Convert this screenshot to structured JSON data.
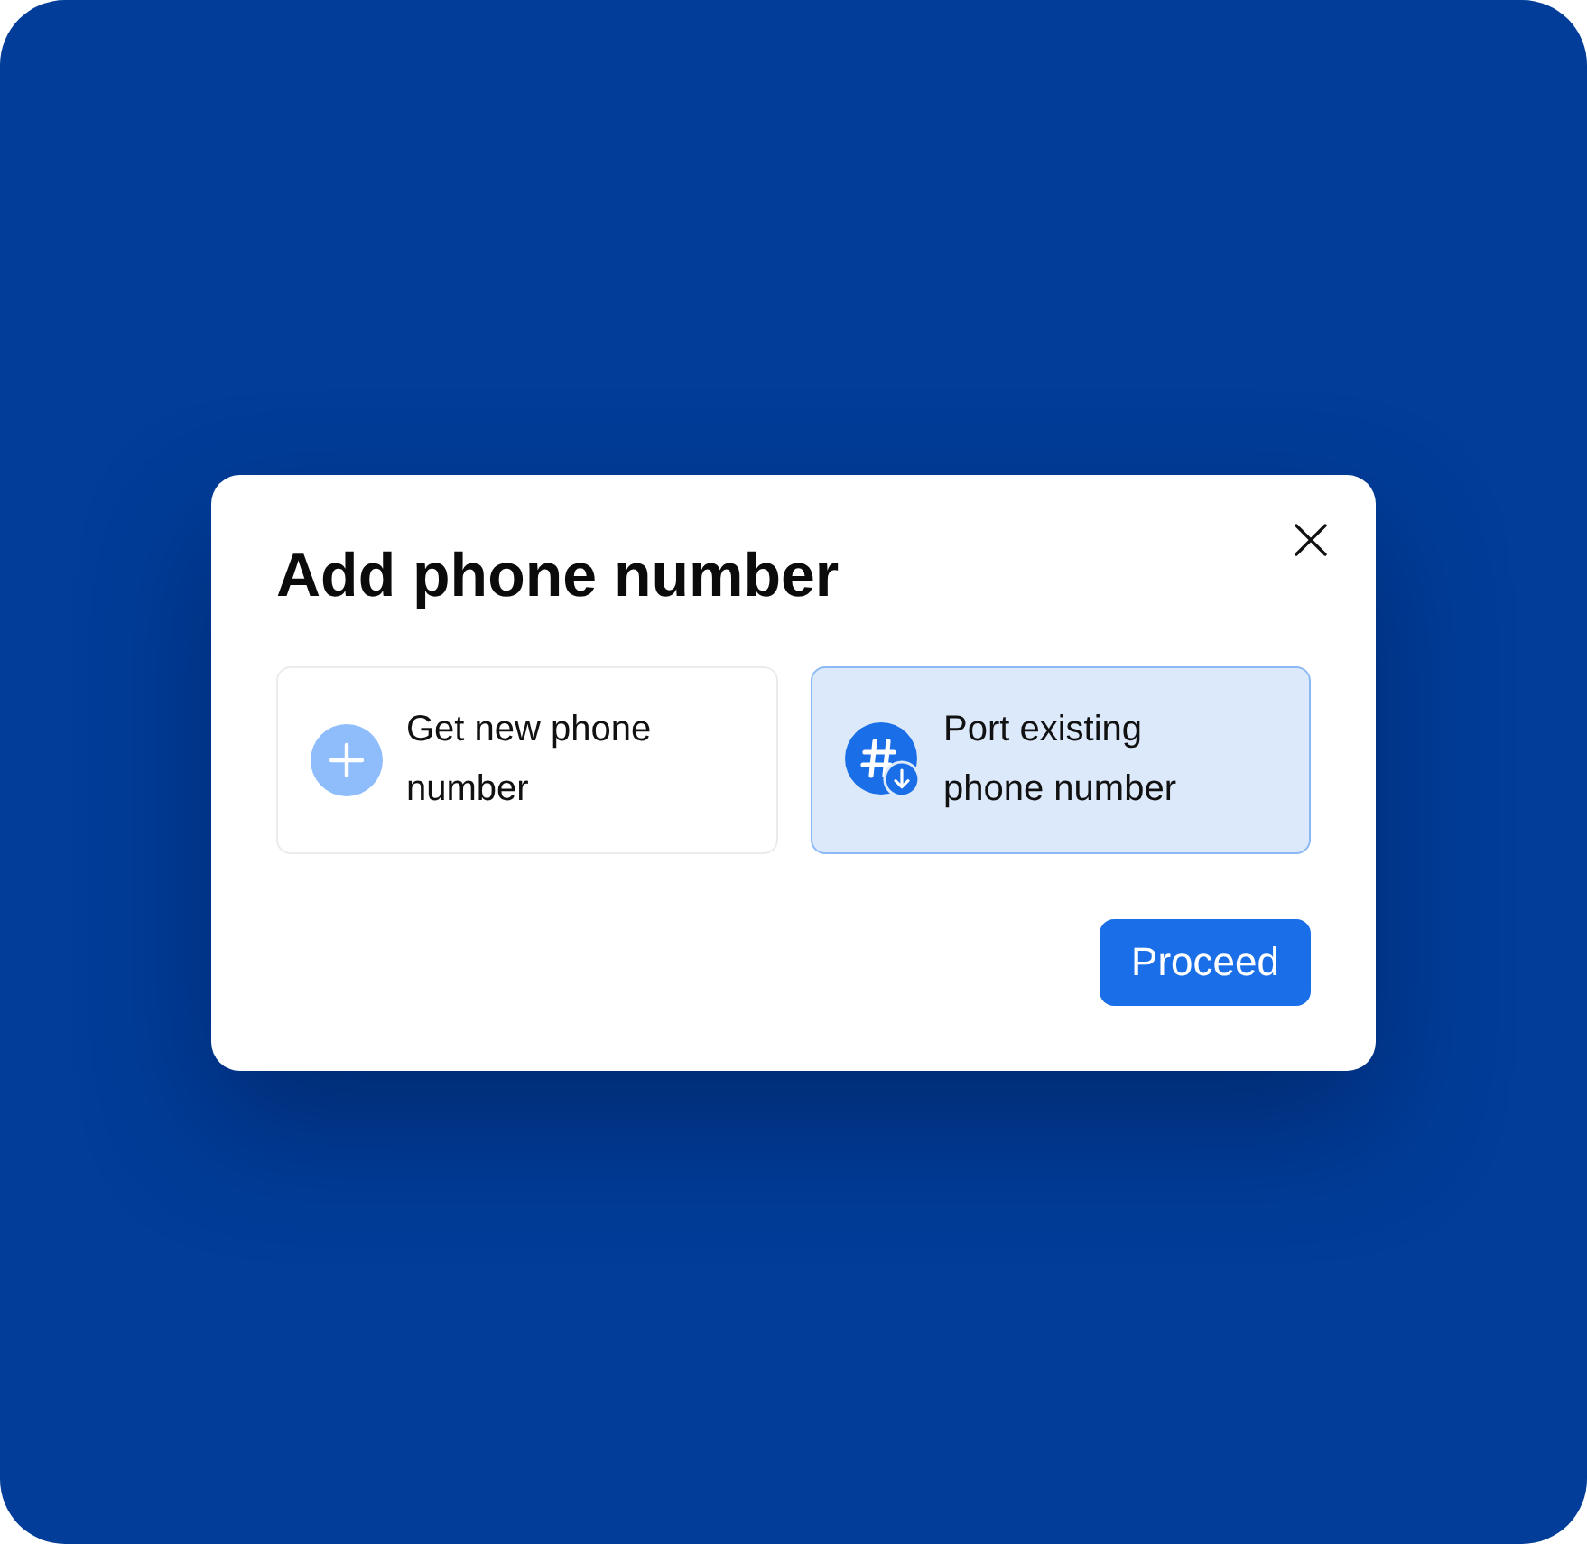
{
  "dialog": {
    "title": "Add phone number"
  },
  "options": [
    {
      "kind": "new",
      "label": "Get new phone number",
      "selected": false
    },
    {
      "kind": "port",
      "label": "Port existing phone number",
      "selected": true
    }
  ],
  "primary_button": {
    "label": "Proceed"
  }
}
